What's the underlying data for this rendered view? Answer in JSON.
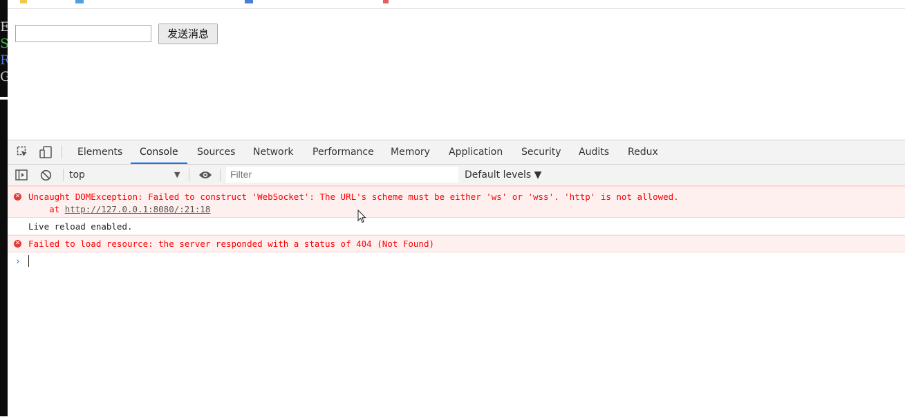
{
  "terminal_strip": {
    "letters": [
      "E",
      "S",
      "R",
      "G"
    ],
    "colors": [
      "#c9c9c9",
      "#3fb04a",
      "#4a7ed8",
      "#c9c9c9"
    ]
  },
  "page": {
    "message_input": {
      "value": "",
      "placeholder": ""
    },
    "send_button_label": "发送消息"
  },
  "devtools": {
    "tabs": [
      {
        "label": "Elements"
      },
      {
        "label": "Console",
        "active": true
      },
      {
        "label": "Sources"
      },
      {
        "label": "Network"
      },
      {
        "label": "Performance"
      },
      {
        "label": "Memory"
      },
      {
        "label": "Application"
      },
      {
        "label": "Security"
      },
      {
        "label": "Audits"
      },
      {
        "label": "Redux"
      }
    ],
    "console_toolbar": {
      "context": "top",
      "filter_placeholder": "Filter",
      "levels_label": "Default levels ▼"
    },
    "messages": [
      {
        "level": "error",
        "text": "Uncaught DOMException: Failed to construct 'WebSocket': The URL's scheme must be either 'ws' or 'wss'. 'http' is not allowed.",
        "stack_prefix": "    at ",
        "stack_link": "http://127.0.0.1:8080/:21:18"
      },
      {
        "level": "info",
        "text": "Live reload enabled."
      },
      {
        "level": "error",
        "text": "Failed to load resource: the server responded with a status of 404 (Not Found)"
      }
    ],
    "prompt_symbol": "›"
  },
  "colors": {
    "error_text": "#ff0000",
    "error_bg": "#fff0f0",
    "active_tab_underline": "#1a73e8"
  }
}
